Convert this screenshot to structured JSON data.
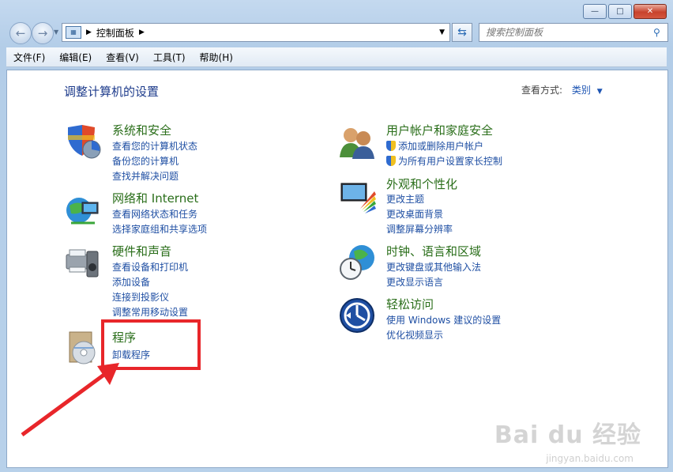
{
  "window": {
    "minimize_glyph": "—",
    "maximize_glyph": "□",
    "close_glyph": "✕"
  },
  "nav": {
    "back_glyph": "←",
    "forward_glyph": "→",
    "address_crumb": "控制面板",
    "address_icon": "control-panel-icon",
    "search_placeholder": "搜索控制面板"
  },
  "menu": [
    "文件(F)",
    "编辑(E)",
    "查看(V)",
    "工具(T)",
    "帮助(H)"
  ],
  "content": {
    "title": "调整计算机的设置",
    "view_by_label": "查看方式:",
    "view_by_value": "类别"
  },
  "categories": {
    "system": {
      "title": "系统和安全",
      "links": [
        "查看您的计算机状态",
        "备份您的计算机",
        "查找并解决问题"
      ]
    },
    "network": {
      "title": "网络和 Internet",
      "links": [
        "查看网络状态和任务",
        "选择家庭组和共享选项"
      ]
    },
    "hardware": {
      "title": "硬件和声音",
      "links": [
        "查看设备和打印机",
        "添加设备",
        "连接到投影仪",
        "调整常用移动设置"
      ]
    },
    "programs": {
      "title": "程序",
      "links": [
        "卸载程序"
      ]
    },
    "users": {
      "title": "用户帐户和家庭安全",
      "links": [
        "添加或删除用户帐户",
        "为所有用户设置家长控制"
      ]
    },
    "appearance": {
      "title": "外观和个性化",
      "links": [
        "更改主题",
        "更改桌面背景",
        "调整屏幕分辨率"
      ]
    },
    "clock": {
      "title": "时钟、语言和区域",
      "links": [
        "更改键盘或其他输入法",
        "更改显示语言"
      ]
    },
    "ease": {
      "title": "轻松访问",
      "links": [
        "使用 Windows 建议的设置",
        "优化视频显示"
      ]
    }
  },
  "watermark": {
    "brand": "Bai du 经验",
    "url": "jingyan.baidu.com"
  },
  "colors": {
    "link": "#1f4fa3",
    "heading": "#2a6e1a",
    "title": "#1e3c8c",
    "annotation": "#e8262a"
  }
}
